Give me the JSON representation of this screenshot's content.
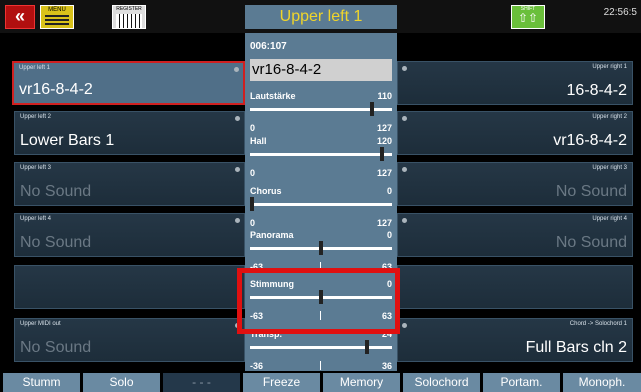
{
  "topbar": {
    "title": "Upper left 1",
    "menu_label": "MENU",
    "keys_label": "REGISTER",
    "shift_label": "SHIFT",
    "time": "22:56:5"
  },
  "left_panels": [
    {
      "label": "Upper left 1",
      "value": "vr16-8-4-2",
      "active": true
    },
    {
      "label": "Upper left 2",
      "value": "Lower Bars 1"
    },
    {
      "label": "Upper left 3",
      "value": "No Sound"
    },
    {
      "label": "Upper left 4",
      "value": "No Sound"
    },
    {
      "label": "",
      "value": ""
    },
    {
      "label": "Upper MIDI out",
      "value": "No Sound"
    }
  ],
  "right_panels": [
    {
      "label": "Upper right 1",
      "value": "16-8-4-2"
    },
    {
      "label": "Upper right 2",
      "value": "vr16-8-4-2"
    },
    {
      "label": "Upper right 3",
      "value": "No Sound"
    },
    {
      "label": "Upper right 4",
      "value": "No Sound"
    },
    {
      "label": "",
      "value": ""
    },
    {
      "label": "Chord ->  Solochord 1",
      "value": "Full Bars cln 2"
    }
  ],
  "center": {
    "preset_number": "006:107",
    "preset_name": "vr16-8-4-2",
    "sliders": [
      {
        "name": "Lautstärke",
        "value": "110",
        "min": "0",
        "max": "127",
        "level": 0.866
      },
      {
        "name": "Hall",
        "value": "120",
        "min": "0",
        "max": "127",
        "level": 0.945
      },
      {
        "name": "Chorus",
        "value": "0",
        "min": "0",
        "max": "127",
        "level": 0.0
      },
      {
        "name": "Panorama",
        "value": "0",
        "min": "-63",
        "max": "63",
        "level": 0.5
      },
      {
        "name": "Stimmung",
        "value": "0",
        "min": "-63",
        "max": "63",
        "level": 0.5
      },
      {
        "name": "Transp.",
        "value": "24",
        "min": "-36",
        "max": "36",
        "level": 0.833
      }
    ]
  },
  "bottom_buttons": [
    {
      "label": "Stumm"
    },
    {
      "label": "Solo"
    },
    {
      "label": "- - -"
    },
    {
      "label": "Freeze"
    },
    {
      "label": "Memory"
    },
    {
      "label": "Solochord"
    },
    {
      "label": "Portam."
    },
    {
      "label": "Monoph."
    }
  ]
}
